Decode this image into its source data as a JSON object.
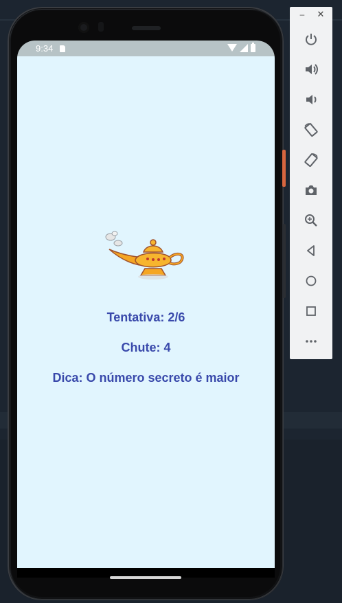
{
  "status_bar": {
    "time": "9:34"
  },
  "app": {
    "attempt": "Tentativa: 2/6",
    "guess": "Chute: 4",
    "hint": "Dica: O número secreto é maior"
  },
  "colors": {
    "app_background": "#e1f5fe",
    "text": "#3949ab",
    "status_bar": "#b7c3c6"
  },
  "toolbar": {
    "window_controls": [
      "minimize-icon",
      "close-icon"
    ],
    "buttons": [
      "power-icon",
      "volume-up-icon",
      "volume-down-icon",
      "rotate-left-icon",
      "rotate-right-icon",
      "camera-icon",
      "zoom-icon",
      "back-icon",
      "home-icon",
      "overview-icon",
      "more-icon"
    ]
  }
}
